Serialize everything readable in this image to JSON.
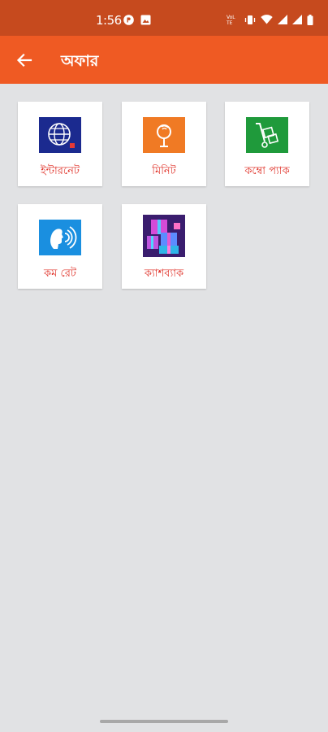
{
  "status_bar": {
    "time": "1:56",
    "left_icons": [
      "app-notification-icon",
      "image-notification-icon"
    ],
    "right_icons": [
      "volte-icon",
      "vibrate-icon",
      "wifi-icon",
      "signal-icon",
      "signal-icon-2",
      "battery-icon"
    ]
  },
  "app_bar": {
    "title": "অফার",
    "back_icon": "arrow-left-icon"
  },
  "tiles": [
    {
      "label": "ইন্টারনেট",
      "icon": "globe-icon",
      "bg": "#1b2a8f"
    },
    {
      "label": "মিনিট",
      "icon": "microphone-icon",
      "bg": "#f07a24"
    },
    {
      "label": "কম্বো প্যাক",
      "icon": "hand-truck-icon",
      "bg": "#1f9a3b"
    },
    {
      "label": "কম রেট",
      "icon": "speaking-head-icon",
      "bg": "#1a8fe0"
    },
    {
      "label": "ক্যাশব্যাক",
      "icon": "gift-boxes-icon",
      "bg": "#3a1d6e"
    }
  ],
  "colors": {
    "status_bar": "#c64a1e",
    "app_bar": "#ef5a23",
    "label_text": "#e0342b",
    "background": "#e1e2e4"
  }
}
